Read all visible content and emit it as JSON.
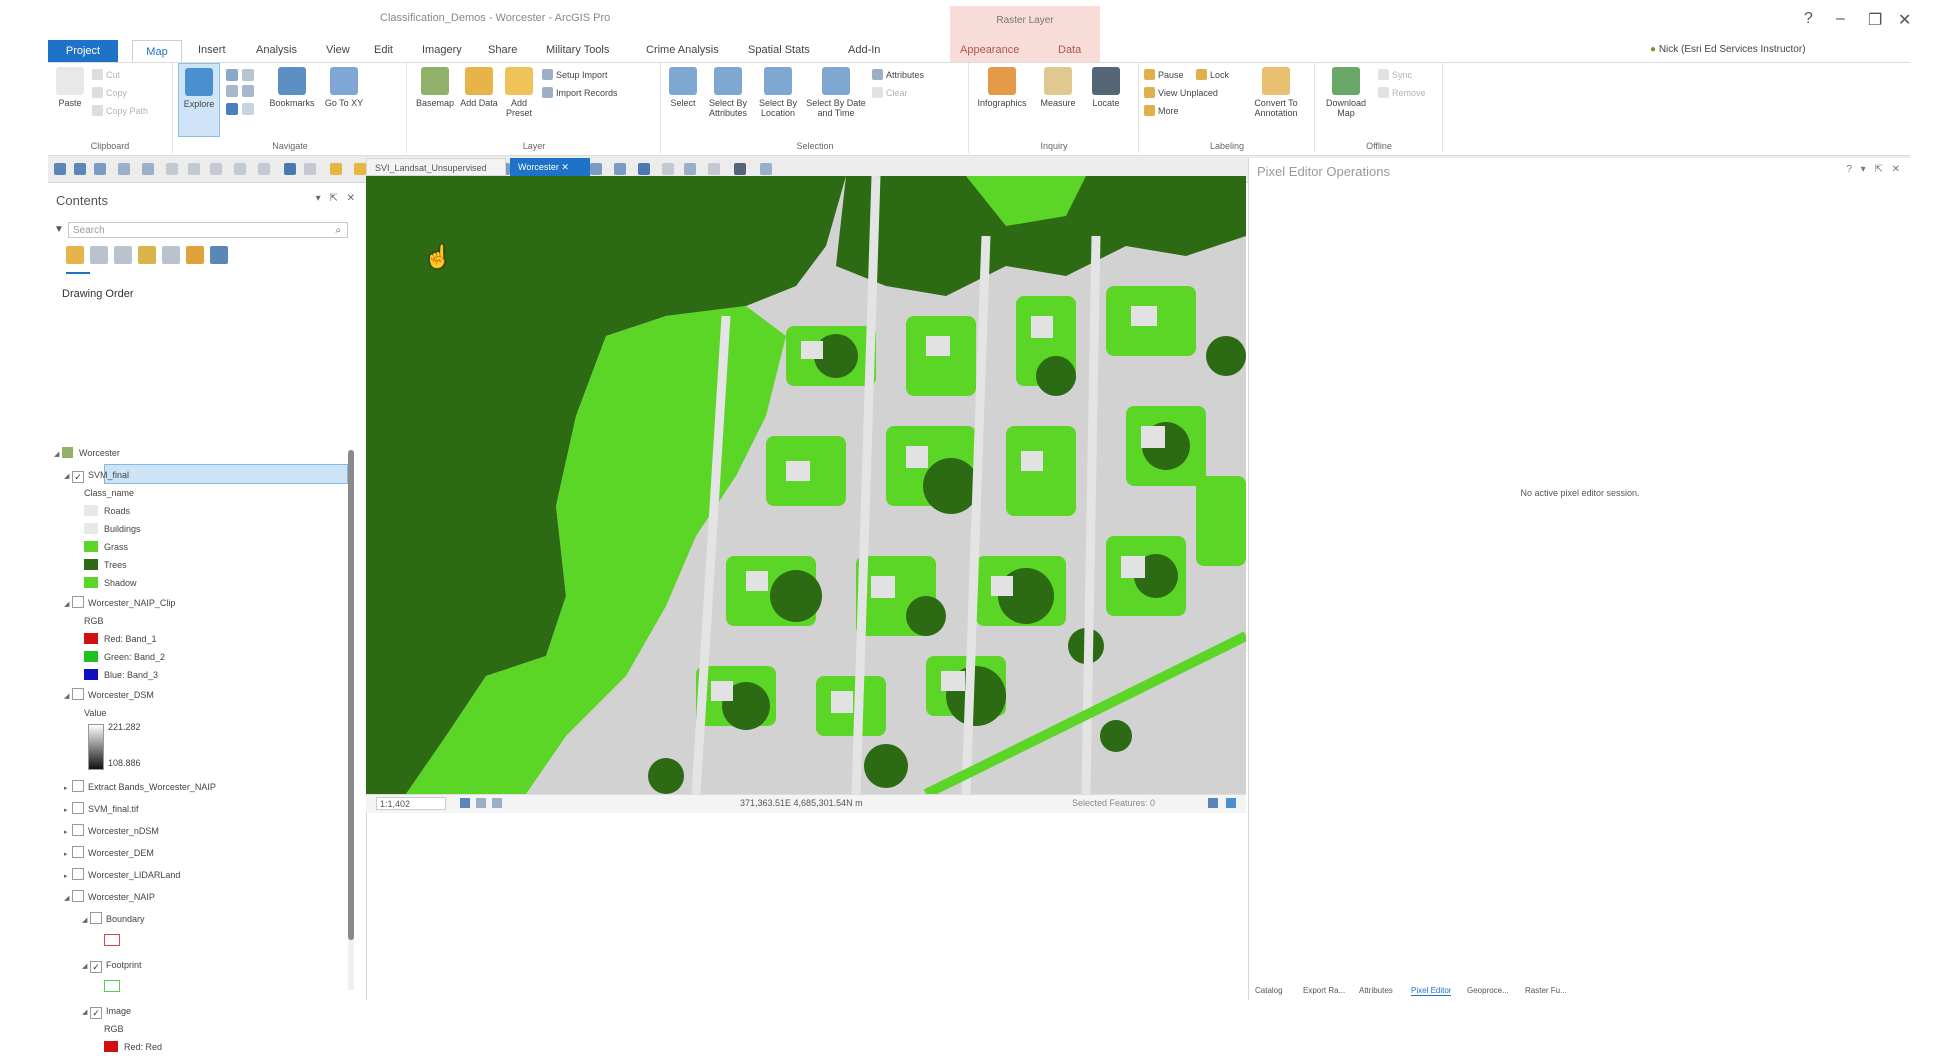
{
  "window": {
    "title": "Classification_Demos - Worcester - ArcGIS Pro",
    "context_group": "Raster Layer",
    "controls": [
      "?",
      "–",
      "❐",
      "✕"
    ]
  },
  "tabs": [
    "Project",
    "Map",
    "Insert",
    "Analysis",
    "View",
    "Edit",
    "Imagery",
    "Share",
    "Military Tools",
    "Crime Analysis",
    "Spatial Stats",
    "Add-In",
    "Appearance",
    "Data"
  ],
  "account": "Nick (Esri Ed Services Instructor)",
  "ribbon": {
    "clipboard": {
      "paste": "Paste",
      "cut": "Cut",
      "copy": "Copy",
      "copy_path": "Copy Path",
      "label": "Clipboard"
    },
    "navigate": {
      "explore": "Explore",
      "bookmarks": "Bookmarks",
      "go_to_xy": "Go To XY",
      "label": "Navigate"
    },
    "layer": {
      "basemap": "Basemap",
      "add_data": "Add Data",
      "add_preset": "Add Preset",
      "setup_import": "Setup Import",
      "import_records": "Import Records",
      "label": "Layer"
    },
    "selection": {
      "select": "Select",
      "by_attributes": "Select By Attributes",
      "by_location": "Select By Location",
      "by_date": "Select By Date and Time",
      "attributes": "Attributes",
      "clear": "Clear",
      "label": "Selection"
    },
    "inquiry": {
      "infographics": "Infographics",
      "measure": "Measure",
      "locate": "Locate",
      "label": "Inquiry"
    },
    "labeling": {
      "pause": "Pause",
      "lock": "Lock",
      "view_unplaced": "View Unplaced",
      "more": "More",
      "convert": "Convert To Annotation",
      "label": "Labeling"
    },
    "offline": {
      "download": "Download Map",
      "sync": "Sync",
      "remove": "Remove",
      "label": "Offline"
    }
  },
  "contents": {
    "title": "Contents",
    "search_placeholder": "Search",
    "drawing_order": "Drawing Order",
    "layers": {
      "map": "Worcester",
      "svm": "SVM_final",
      "class_name": "Class_name",
      "roads": "Roads",
      "buildings": "Buildings",
      "grass": "Grass",
      "trees": "Trees",
      "shadow": "Shadow",
      "naip_clip": "Worcester_NAIP_Clip",
      "rgb": "RGB",
      "red": "Red: Band_1",
      "green": "Green: Band_2",
      "blue": "Blue: Band_3",
      "dsm": "Worcester_DSM",
      "value": "Value",
      "high": "221.282",
      "low": "108.886",
      "extract": "Extract Bands_Worcester_NAIP",
      "svm_tif": "SVM_final.tif",
      "ndsm": "Worcester_nDSM",
      "dem": "Worcester_DEM",
      "lidar": "Worcester_LIDARLand",
      "naip": "Worcester_NAIP",
      "boundary": "Boundary",
      "footprint": "Footprint",
      "image": "Image",
      "rgb2": "RGB",
      "red2": "Red: Red"
    }
  },
  "map": {
    "tabs": [
      "SVI_Landsat_Unsupervised",
      "Worcester"
    ],
    "scale": "1:1,402",
    "coordinates": "371,363.51E 4,685,301.54N m",
    "selected_features": "Selected Features: 0"
  },
  "pixel_editor": {
    "title": "Pixel Editor Operations",
    "message": "No active pixel editor session."
  },
  "bottom_tabs": [
    "Catalog",
    "Export Ra...",
    "Attributes",
    "Pixel Editor",
    "Geoproce...",
    "Raster Fu..."
  ],
  "colors": {
    "trees": "#2c6a14",
    "grass": "#5cd626",
    "developed": "#d2d2d2",
    "accent": "#1e73c8"
  }
}
